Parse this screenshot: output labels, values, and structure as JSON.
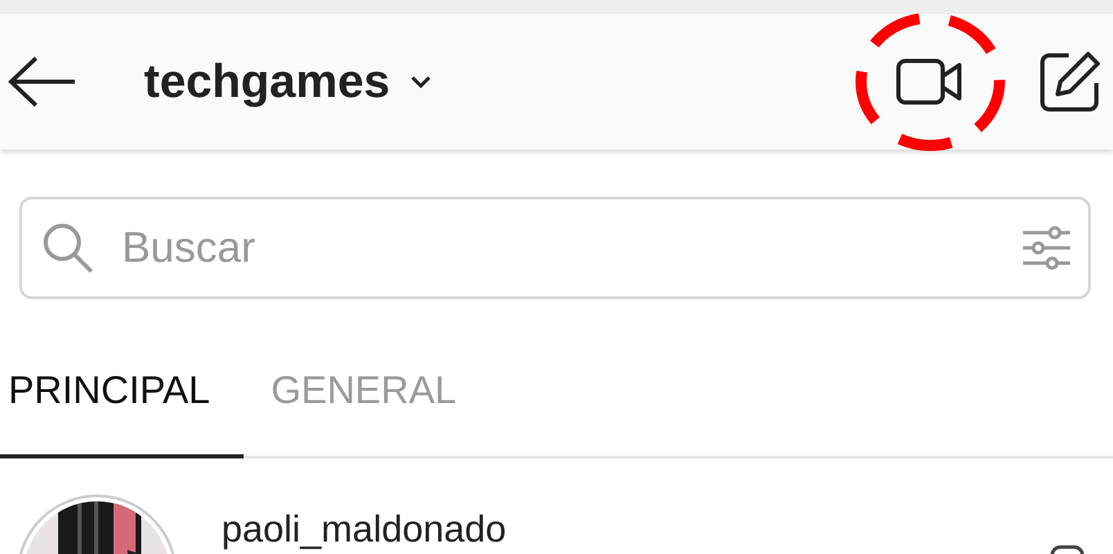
{
  "header": {
    "title": "techgames"
  },
  "search": {
    "placeholder": "Buscar"
  },
  "tabs": [
    {
      "label": "PRINCIPAL",
      "selected": true
    },
    {
      "label": "GENERAL",
      "selected": false
    }
  ],
  "conversations": [
    {
      "username": "paoli_maldonado"
    }
  ]
}
